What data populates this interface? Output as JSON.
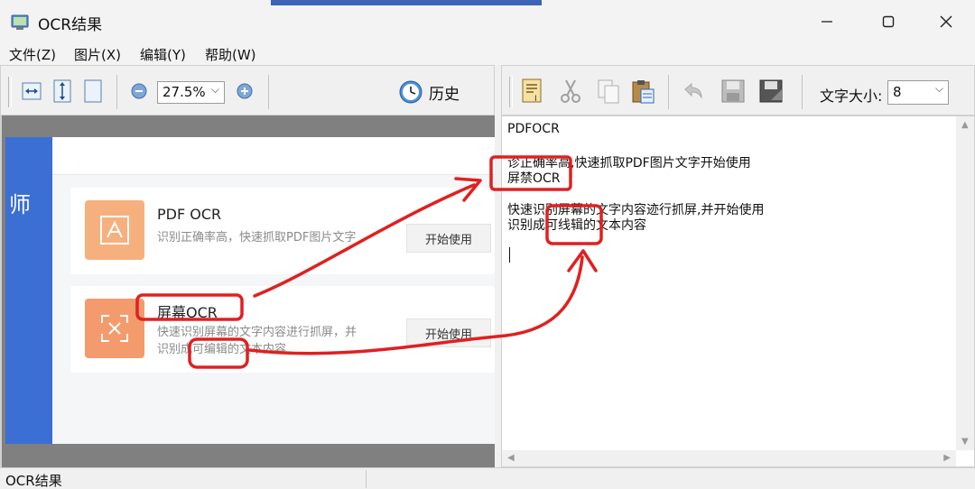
{
  "window": {
    "title": "OCR结果",
    "minimize_label": "—",
    "maximize_label": "☐",
    "close_label": "✕"
  },
  "menu": {
    "items": [
      {
        "label": "文件(Z)"
      },
      {
        "label": "图片(X)"
      },
      {
        "label": "编辑(Y)"
      },
      {
        "label": "帮助(W)"
      }
    ]
  },
  "image_toolbar": {
    "zoom_value": "27.5%",
    "history_label": "历史"
  },
  "text_toolbar": {
    "font_size_label": "文字大小:",
    "font_size_value": "8"
  },
  "screenshot": {
    "sidebar_text": "师",
    "card1": {
      "title": "PDF OCR",
      "desc": "识别正确率高，快速抓取PDF图片文字",
      "button": "开始使用"
    },
    "card2": {
      "title": "屏幕OCR",
      "desc_line1": "快速识别屏幕的文字内容进行抓屏，并",
      "desc_line2": "识别成可编辑的文本内容",
      "button": "开始使用"
    }
  },
  "ocr_text": {
    "lines": [
      "PDFOCR",
      "",
      "诊正确率高,快速抓取PDF图片文字开始使用",
      "屏禁OCR",
      "",
      "快速识别屏幕的文字内容迹行抓屏,并开始使用",
      "识别成可线辑的文本内容"
    ]
  },
  "status": {
    "text": "OCR结果"
  },
  "colors": {
    "accent_blue": "#3b6fd4",
    "annotation_red": "#e02020",
    "card_orange": "#f5a26a"
  }
}
